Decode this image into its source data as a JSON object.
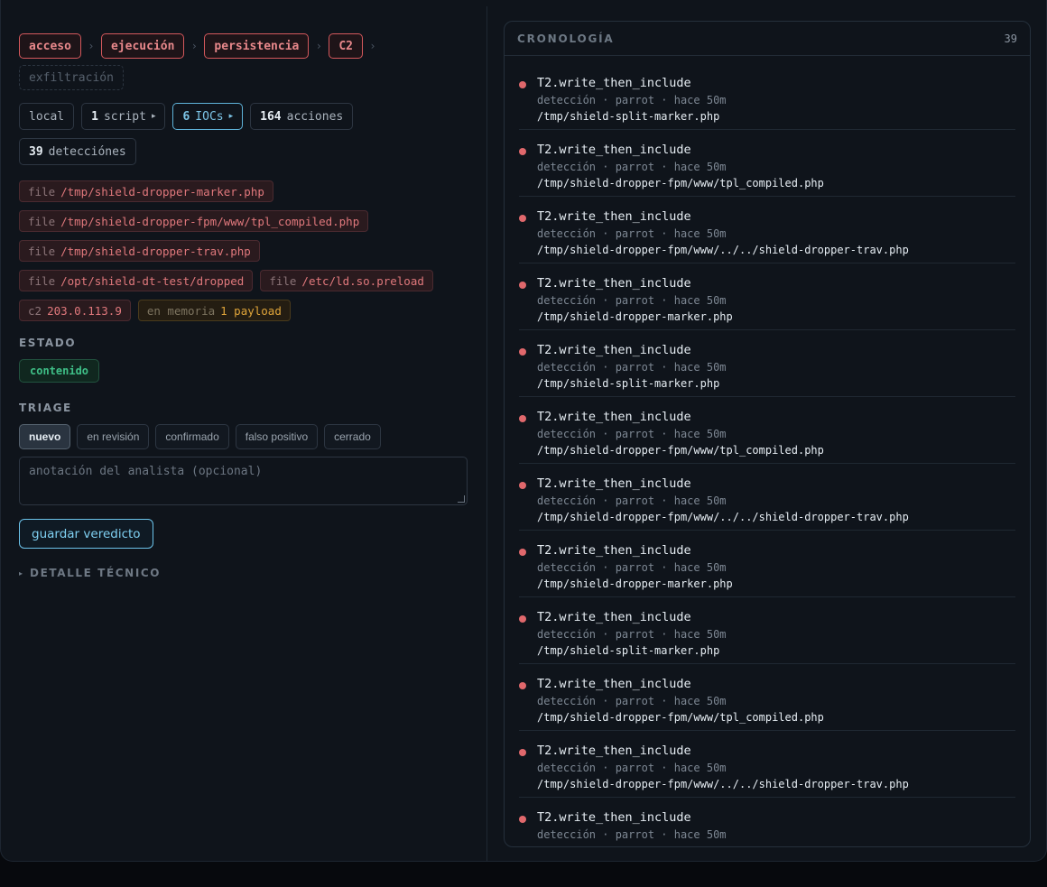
{
  "kill_chain": [
    {
      "label": "acceso",
      "dim": false
    },
    {
      "label": "ejecución",
      "dim": false
    },
    {
      "label": "persistencia",
      "dim": false
    },
    {
      "label": "C2",
      "dim": false
    },
    {
      "label": "exfiltración",
      "dim": true
    }
  ],
  "chain_separator": "›",
  "summary": {
    "scope": "local",
    "scripts_count": "1",
    "scripts_label": "script",
    "iocs_count": "6",
    "iocs_label": "IOCs",
    "actions_count": "164",
    "actions_label": "acciones",
    "detections_count": "39",
    "detections_label": "detecciónes",
    "expand_glyph": "▸"
  },
  "iocs": [
    {
      "kind": "file",
      "value": "/tmp/shield-dropper-marker.php",
      "tone": "red"
    },
    {
      "kind": "file",
      "value": "/tmp/shield-dropper-fpm/www/tpl_compiled.php",
      "tone": "red"
    },
    {
      "kind": "file",
      "value": "/tmp/shield-dropper-trav.php",
      "tone": "red"
    },
    {
      "kind": "file",
      "value": "/opt/shield-dt-test/dropped",
      "tone": "red"
    },
    {
      "kind": "file",
      "value": "/etc/ld.so.preload",
      "tone": "red"
    },
    {
      "kind": "c2",
      "value": "203.0.113.9",
      "tone": "red"
    },
    {
      "kind": "en memoria",
      "value": "1 payload",
      "tone": "amber"
    }
  ],
  "estado": {
    "heading": "ESTADO",
    "value": "contenido"
  },
  "triage": {
    "heading": "TRIAGE",
    "options": [
      "nuevo",
      "en revisión",
      "confirmado",
      "falso positivo",
      "cerrado"
    ],
    "selected": "nuevo",
    "note_placeholder": "anotación del analista (opcional)",
    "save_label": "guardar veredicto"
  },
  "detail": {
    "glyph": "▸",
    "label": "DETALLE TÉCNICO"
  },
  "timeline": {
    "title": "CRONOLOGÍA",
    "count": "39",
    "events": [
      {
        "title": "T2.write_then_include",
        "meta": "detección · parrot · hace 50m",
        "path": "/tmp/shield-split-marker.php"
      },
      {
        "title": "T2.write_then_include",
        "meta": "detección · parrot · hace 50m",
        "path": "/tmp/shield-dropper-fpm/www/tpl_compiled.php"
      },
      {
        "title": "T2.write_then_include",
        "meta": "detección · parrot · hace 50m",
        "path": "/tmp/shield-dropper-fpm/www/../../shield-dropper-trav.php"
      },
      {
        "title": "T2.write_then_include",
        "meta": "detección · parrot · hace 50m",
        "path": "/tmp/shield-dropper-marker.php"
      },
      {
        "title": "T2.write_then_include",
        "meta": "detección · parrot · hace 50m",
        "path": "/tmp/shield-split-marker.php"
      },
      {
        "title": "T2.write_then_include",
        "meta": "detección · parrot · hace 50m",
        "path": "/tmp/shield-dropper-fpm/www/tpl_compiled.php"
      },
      {
        "title": "T2.write_then_include",
        "meta": "detección · parrot · hace 50m",
        "path": "/tmp/shield-dropper-fpm/www/../../shield-dropper-trav.php"
      },
      {
        "title": "T2.write_then_include",
        "meta": "detección · parrot · hace 50m",
        "path": "/tmp/shield-dropper-marker.php"
      },
      {
        "title": "T2.write_then_include",
        "meta": "detección · parrot · hace 50m",
        "path": "/tmp/shield-split-marker.php"
      },
      {
        "title": "T2.write_then_include",
        "meta": "detección · parrot · hace 50m",
        "path": "/tmp/shield-dropper-fpm/www/tpl_compiled.php"
      },
      {
        "title": "T2.write_then_include",
        "meta": "detección · parrot · hace 50m",
        "path": "/tmp/shield-dropper-fpm/www/../../shield-dropper-trav.php"
      },
      {
        "title": "T2.write_then_include",
        "meta": "detección · parrot · hace 50m",
        "path": ""
      }
    ]
  },
  "colors": {
    "background": "#0f141b",
    "danger": "#e0686c",
    "accent": "#7cc4e6",
    "ok": "#3fbf87",
    "warning": "#e0a53a"
  }
}
